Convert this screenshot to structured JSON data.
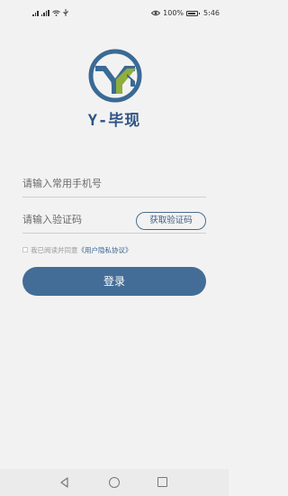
{
  "status_bar": {
    "battery_percent": "100%",
    "time": "5:46"
  },
  "brand": {
    "name": "Y-毕现"
  },
  "form": {
    "phone_placeholder": "请输入常用手机号",
    "code_placeholder": "请输入验证码",
    "get_code_label": "获取验证码"
  },
  "agreement": {
    "prefix": "我已阅读并同意",
    "link": "《用户隐私协议》",
    "checked": false
  },
  "login_label": "登录",
  "colors": {
    "accent": "#436d96",
    "logo_ring": "#3a6a95",
    "logo_y": "#8fae3c",
    "background": "#f2f2f2"
  },
  "icons": {
    "status_left": [
      "signal-icon",
      "signal-icon",
      "wifi-icon",
      "usb-icon"
    ],
    "status_right": [
      "eye-icon",
      "battery-icon"
    ],
    "nav": [
      "back-icon",
      "home-icon",
      "recent-apps-icon"
    ]
  }
}
